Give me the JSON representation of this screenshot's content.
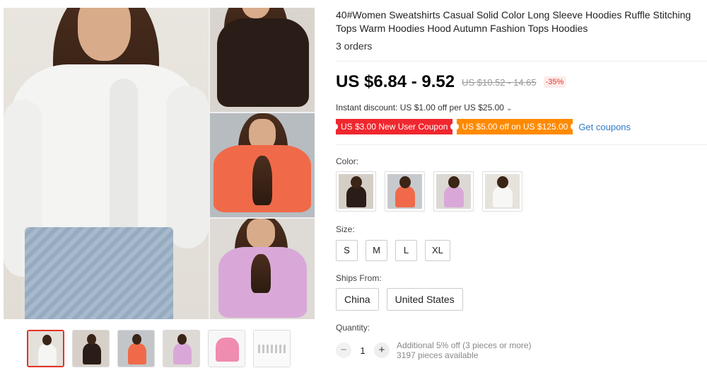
{
  "product": {
    "title": "40#Women Sweatshirts Casual Solid Color Long Sleeve Hoodies Ruffle Stitching Tops Warm Hoodies Hood Autumn Fashion Tops Hoodies",
    "orders": "3 orders"
  },
  "pricing": {
    "price": "US $6.84 - 9.52",
    "original": "US $10.52 - 14.65",
    "discount": "-35%",
    "instant_discount": "Instant discount: US $1.00 off per US $25.00",
    "instant_chevron": "⌄"
  },
  "coupons": {
    "new_user": "US $3.00 New User Coupon",
    "store": "US $5.00 off on US $125.00",
    "get_label": "Get coupons"
  },
  "color": {
    "label": "Color:",
    "options": [
      "black",
      "orange",
      "pink",
      "white"
    ]
  },
  "size": {
    "label": "Size:",
    "options": [
      "S",
      "M",
      "L",
      "XL"
    ]
  },
  "ships_from": {
    "label": "Ships From:",
    "options": [
      "China",
      "United States"
    ]
  },
  "quantity": {
    "label": "Quantity:",
    "value": "1",
    "minus": "−",
    "plus": "+",
    "note_line1": "Additional 5% off (3 pieces or more)",
    "note_line2": "3197 pieces available"
  },
  "gallery": {
    "thumbnails": [
      "white",
      "black",
      "orange",
      "pink",
      "pink-flat",
      "size-chart"
    ],
    "selected_index": 0
  },
  "colors": {
    "accent_red": "#e43225",
    "coupon_red": "#f0272e",
    "coupon_orange": "#ff8a00",
    "link_blue": "#2e79c6"
  }
}
